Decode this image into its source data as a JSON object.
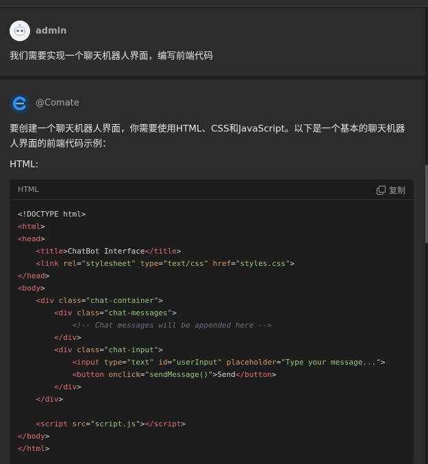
{
  "messages": {
    "user": {
      "name": "admin",
      "text": "我们需要实现一个聊天机器人界面，编写前端代码"
    },
    "bot": {
      "name": "@Comate",
      "intro": "要创建一个聊天机器人界面，你需要使用HTML、CSS和JavaScript。以下是一个基本的聊天机器人界面的前端代码示例：",
      "section_label": "HTML:",
      "code_block": {
        "language": "HTML",
        "copy_label": "复制",
        "lines": [
          [
            {
              "t": "plain",
              "v": "<!DOCTYPE html>"
            }
          ],
          [
            {
              "t": "tag",
              "v": "<html"
            },
            {
              "t": "plain",
              "v": ">"
            }
          ],
          [
            {
              "t": "tag",
              "v": "<head"
            },
            {
              "t": "plain",
              "v": ">"
            }
          ],
          [
            {
              "t": "plain",
              "v": "    "
            },
            {
              "t": "tag",
              "v": "<title"
            },
            {
              "t": "plain",
              "v": ">ChatBot Interface"
            },
            {
              "t": "tag",
              "v": "</title"
            },
            {
              "t": "plain",
              "v": ">"
            }
          ],
          [
            {
              "t": "plain",
              "v": "    "
            },
            {
              "t": "tag",
              "v": "<link"
            },
            {
              "t": "plain",
              "v": " "
            },
            {
              "t": "attr",
              "v": "rel"
            },
            {
              "t": "plain",
              "v": "="
            },
            {
              "t": "str",
              "v": "\"stylesheet\""
            },
            {
              "t": "plain",
              "v": " "
            },
            {
              "t": "attr",
              "v": "type"
            },
            {
              "t": "plain",
              "v": "="
            },
            {
              "t": "str",
              "v": "\"text/css\""
            },
            {
              "t": "plain",
              "v": " "
            },
            {
              "t": "attr",
              "v": "href"
            },
            {
              "t": "plain",
              "v": "="
            },
            {
              "t": "str",
              "v": "\"styles.css\""
            },
            {
              "t": "plain",
              "v": ">"
            }
          ],
          [
            {
              "t": "tag",
              "v": "</head"
            },
            {
              "t": "plain",
              "v": ">"
            }
          ],
          [
            {
              "t": "tag",
              "v": "<body"
            },
            {
              "t": "plain",
              "v": ">"
            }
          ],
          [
            {
              "t": "plain",
              "v": "    "
            },
            {
              "t": "tag",
              "v": "<div"
            },
            {
              "t": "plain",
              "v": " "
            },
            {
              "t": "attr",
              "v": "class"
            },
            {
              "t": "plain",
              "v": "="
            },
            {
              "t": "str",
              "v": "\"chat-container\""
            },
            {
              "t": "plain",
              "v": ">"
            }
          ],
          [
            {
              "t": "plain",
              "v": "        "
            },
            {
              "t": "tag",
              "v": "<div"
            },
            {
              "t": "plain",
              "v": " "
            },
            {
              "t": "attr",
              "v": "class"
            },
            {
              "t": "plain",
              "v": "="
            },
            {
              "t": "str",
              "v": "\"chat-messages\""
            },
            {
              "t": "plain",
              "v": ">"
            }
          ],
          [
            {
              "t": "plain",
              "v": "            "
            },
            {
              "t": "cmt",
              "v": "<!-- Chat messages will be appended here -->"
            }
          ],
          [
            {
              "t": "plain",
              "v": "        "
            },
            {
              "t": "tag",
              "v": "</div"
            },
            {
              "t": "plain",
              "v": ">"
            }
          ],
          [
            {
              "t": "plain",
              "v": "        "
            },
            {
              "t": "tag",
              "v": "<div"
            },
            {
              "t": "plain",
              "v": " "
            },
            {
              "t": "attr",
              "v": "class"
            },
            {
              "t": "plain",
              "v": "="
            },
            {
              "t": "str",
              "v": "\"chat-input\""
            },
            {
              "t": "plain",
              "v": ">"
            }
          ],
          [
            {
              "t": "plain",
              "v": "            "
            },
            {
              "t": "tag",
              "v": "<input"
            },
            {
              "t": "plain",
              "v": " "
            },
            {
              "t": "attr",
              "v": "type"
            },
            {
              "t": "plain",
              "v": "="
            },
            {
              "t": "str",
              "v": "\"text\""
            },
            {
              "t": "plain",
              "v": " "
            },
            {
              "t": "attr",
              "v": "id"
            },
            {
              "t": "plain",
              "v": "="
            },
            {
              "t": "str",
              "v": "\"userInput\""
            },
            {
              "t": "plain",
              "v": " "
            },
            {
              "t": "attr",
              "v": "placeholder"
            },
            {
              "t": "plain",
              "v": "="
            },
            {
              "t": "str",
              "v": "\"Type your message...\""
            },
            {
              "t": "plain",
              "v": ">"
            }
          ],
          [
            {
              "t": "plain",
              "v": "            "
            },
            {
              "t": "tag",
              "v": "<button"
            },
            {
              "t": "plain",
              "v": " "
            },
            {
              "t": "attr",
              "v": "onclick"
            },
            {
              "t": "plain",
              "v": "="
            },
            {
              "t": "str",
              "v": "\"sendMessage()\""
            },
            {
              "t": "plain",
              "v": ">Send"
            },
            {
              "t": "tag",
              "v": "</button"
            },
            {
              "t": "plain",
              "v": ">"
            }
          ],
          [
            {
              "t": "plain",
              "v": "        "
            },
            {
              "t": "tag",
              "v": "</div"
            },
            {
              "t": "plain",
              "v": ">"
            }
          ],
          [
            {
              "t": "plain",
              "v": "    "
            },
            {
              "t": "tag",
              "v": "</div"
            },
            {
              "t": "plain",
              "v": ">"
            }
          ],
          [
            {
              "t": "plain",
              "v": ""
            }
          ],
          [
            {
              "t": "plain",
              "v": "    "
            },
            {
              "t": "tag",
              "v": "<script"
            },
            {
              "t": "plain",
              "v": " "
            },
            {
              "t": "attr",
              "v": "src"
            },
            {
              "t": "plain",
              "v": "="
            },
            {
              "t": "str",
              "v": "\"script.js\""
            },
            {
              "t": "plain",
              "v": ">"
            },
            {
              "t": "tag",
              "v": "</script"
            },
            {
              "t": "plain",
              "v": ">"
            }
          ],
          [
            {
              "t": "tag",
              "v": "</body"
            },
            {
              "t": "plain",
              "v": ">"
            }
          ],
          [
            {
              "t": "tag",
              "v": "</html"
            },
            {
              "t": "plain",
              "v": ">"
            }
          ]
        ]
      }
    }
  },
  "icons": {
    "admin_avatar": "robot-face-icon",
    "bot_avatar": "comate-logo-icon",
    "copy": "copy-icon"
  },
  "colors": {
    "background": "#1f1f1f",
    "message_bg": "#2c2c2c",
    "code_bg": "#1d1d1d",
    "tag": "#e06c75",
    "attribute": "#d19a66",
    "string": "#98c379",
    "comment": "#676e7a",
    "bot_logo_blue": "#2f8ef6"
  }
}
